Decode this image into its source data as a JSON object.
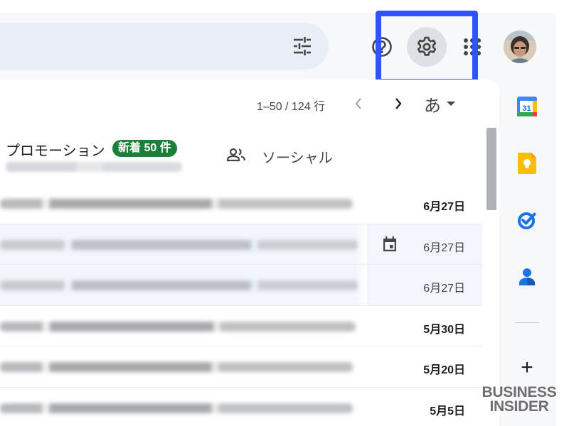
{
  "header": {
    "icons": [
      "filter-icon",
      "help-icon",
      "settings-icon",
      "apps-grid-icon"
    ]
  },
  "toolbar": {
    "pagination": "1–50 / 124 行",
    "input_tool": "あ"
  },
  "tabs": [
    {
      "label": "プロモーション",
      "badge": "新着 50 件",
      "badge_color": "#188038"
    },
    {
      "label": "ソーシャル"
    }
  ],
  "emails": [
    {
      "date": "6月27日",
      "read": false,
      "has_calendar": false
    },
    {
      "date": "6月27日",
      "read": true,
      "has_calendar": true
    },
    {
      "date": "6月27日",
      "read": true,
      "has_calendar": false
    },
    {
      "date": "5月30日",
      "read": false,
      "has_calendar": false
    },
    {
      "date": "5月20日",
      "read": false,
      "has_calendar": false
    },
    {
      "date": "5月5日",
      "read": false,
      "has_calendar": false
    }
  ],
  "side_panel": {
    "apps": [
      "calendar-app-icon",
      "keep-app-icon",
      "tasks-app-icon",
      "contacts-app-icon"
    ],
    "calendar_day": "31",
    "add_label": "+"
  },
  "watermark": {
    "line1": "BUSINESS",
    "line2": "INSIDER"
  },
  "colors": {
    "highlight": "#3152ff",
    "badge": "#188038",
    "search_bg": "#e9eef6",
    "app_bg": "#f6f8fc"
  }
}
